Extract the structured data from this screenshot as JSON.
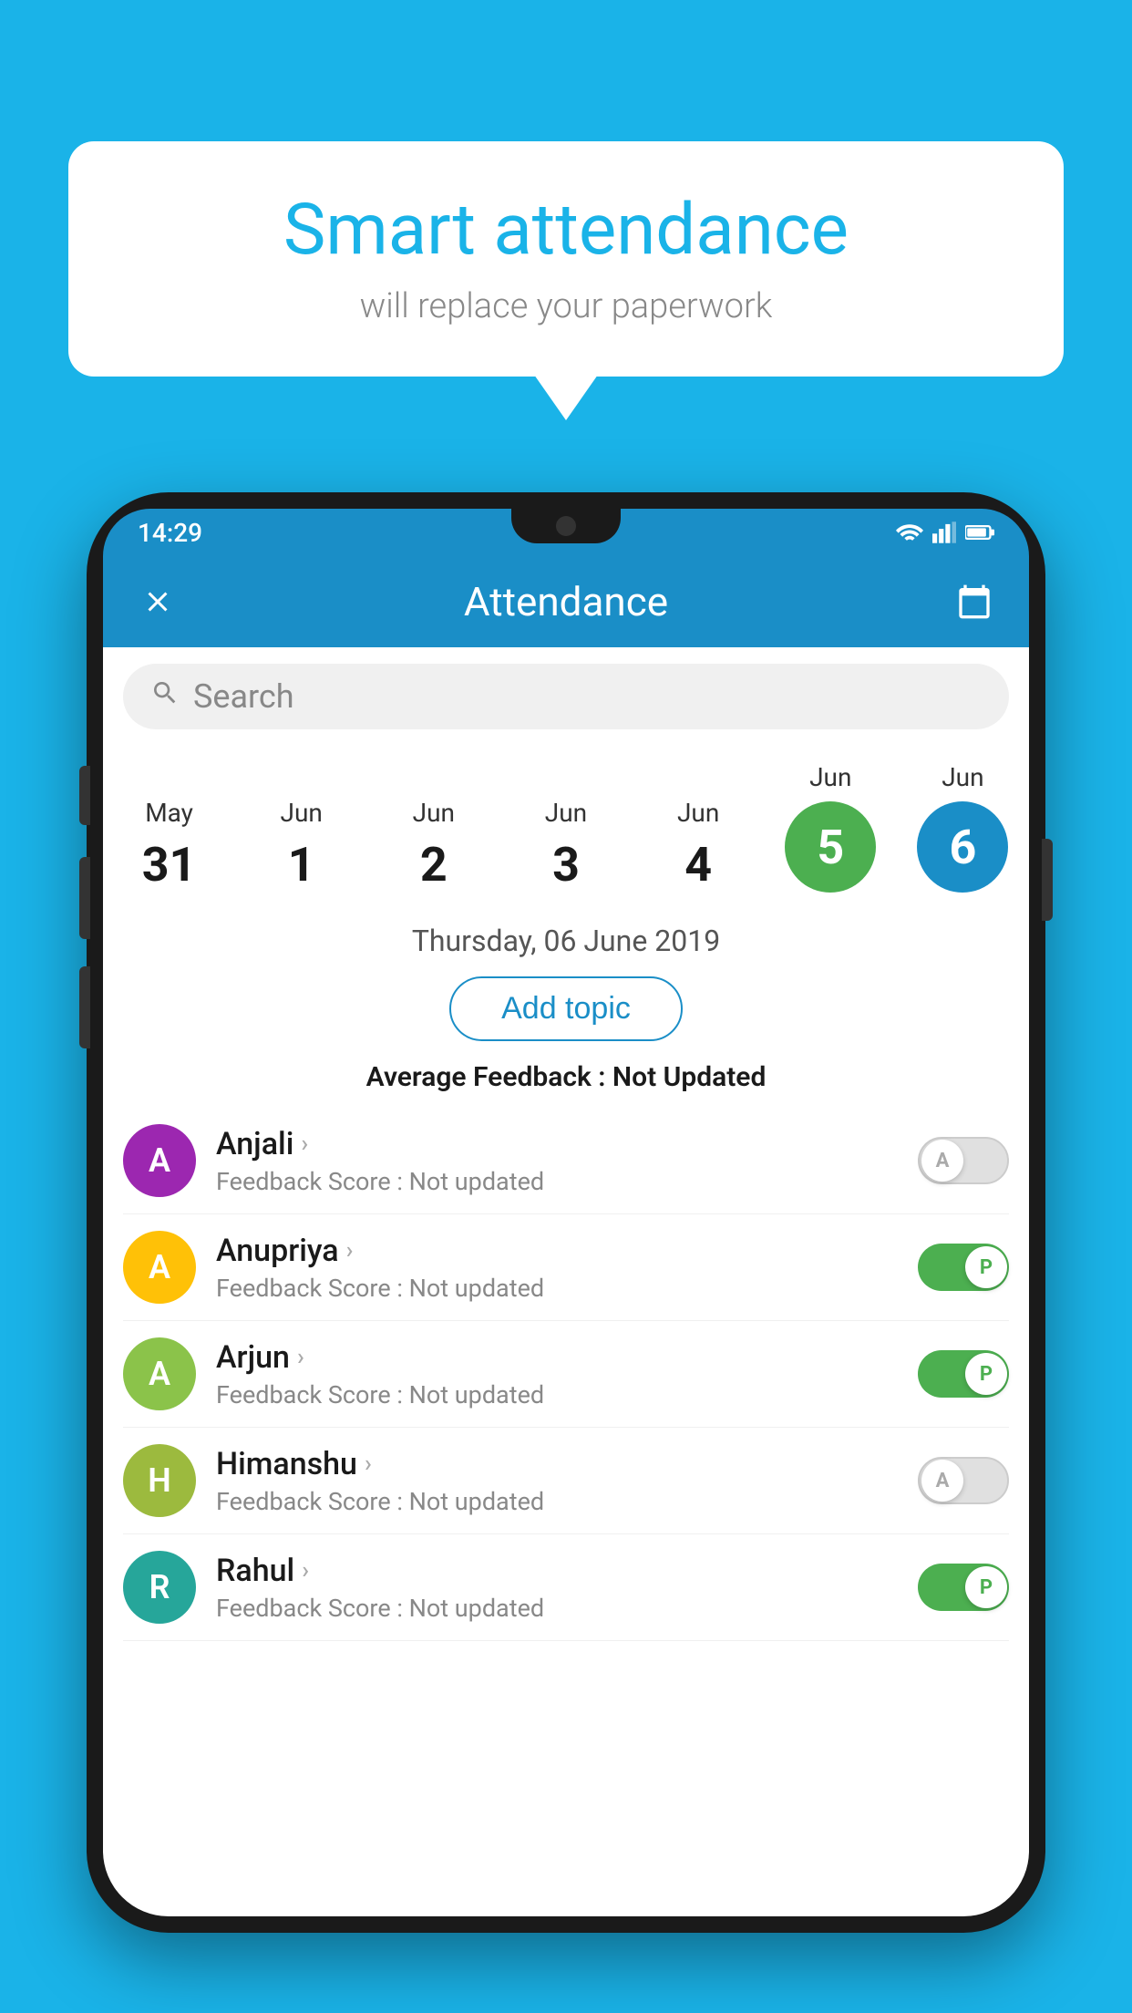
{
  "background_color": "#1ab3e8",
  "bubble": {
    "title": "Smart attendance",
    "subtitle": "will replace your paperwork"
  },
  "phone": {
    "status_bar": {
      "time": "14:29",
      "icons": [
        "wifi",
        "signal",
        "battery"
      ]
    },
    "app_bar": {
      "close_label": "×",
      "title": "Attendance",
      "calendar_label": "📅"
    },
    "search": {
      "placeholder": "Search"
    },
    "date_strip": {
      "dates": [
        {
          "month": "May",
          "day": "31",
          "circle": false
        },
        {
          "month": "Jun",
          "day": "1",
          "circle": false
        },
        {
          "month": "Jun",
          "day": "2",
          "circle": false
        },
        {
          "month": "Jun",
          "day": "3",
          "circle": false
        },
        {
          "month": "Jun",
          "day": "4",
          "circle": false
        },
        {
          "month": "Jun",
          "day": "5",
          "circle": true,
          "circle_color": "green"
        },
        {
          "month": "Jun",
          "day": "6",
          "circle": true,
          "circle_color": "blue"
        }
      ]
    },
    "selected_date": "Thursday, 06 June 2019",
    "add_topic_label": "Add topic",
    "avg_feedback_label": "Average Feedback :",
    "avg_feedback_value": "Not Updated",
    "students": [
      {
        "name": "Anjali",
        "avatar_letter": "A",
        "avatar_color": "purple",
        "feedback_label": "Feedback Score :",
        "feedback_value": "Not updated",
        "toggle": "off",
        "toggle_letter": "A"
      },
      {
        "name": "Anupriya",
        "avatar_letter": "A",
        "avatar_color": "yellow",
        "feedback_label": "Feedback Score :",
        "feedback_value": "Not updated",
        "toggle": "on",
        "toggle_letter": "P"
      },
      {
        "name": "Arjun",
        "avatar_letter": "A",
        "avatar_color": "green",
        "feedback_label": "Feedback Score :",
        "feedback_value": "Not updated",
        "toggle": "on",
        "toggle_letter": "P"
      },
      {
        "name": "Himanshu",
        "avatar_letter": "H",
        "avatar_color": "olive",
        "feedback_label": "Feedback Score :",
        "feedback_value": "Not updated",
        "toggle": "off",
        "toggle_letter": "A"
      },
      {
        "name": "Rahul",
        "avatar_letter": "R",
        "avatar_color": "teal",
        "feedback_label": "Feedback Score :",
        "feedback_value": "Not updated",
        "toggle": "on",
        "toggle_letter": "P"
      }
    ]
  }
}
